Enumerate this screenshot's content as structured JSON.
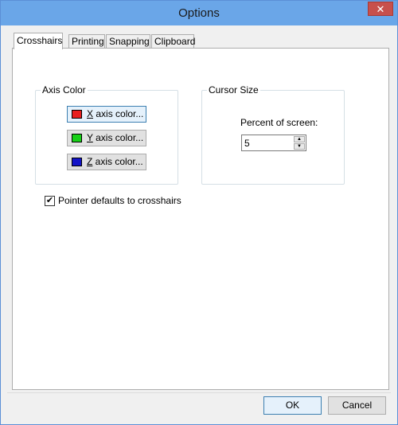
{
  "window": {
    "title": "Options",
    "close_label": "✕"
  },
  "tabs": [
    {
      "label": "Crosshairs",
      "active": true
    },
    {
      "label": "Printing",
      "active": false
    },
    {
      "label": "Snapping",
      "active": false
    },
    {
      "label": "Clipboard",
      "active": false
    }
  ],
  "axis_color": {
    "group_label": "Axis Color",
    "buttons": [
      {
        "label": "X axis color...",
        "accel": "X",
        "rest": " axis color...",
        "color": "#e8201e"
      },
      {
        "label": "Y axis color...",
        "accel": "Y",
        "rest": " axis color...",
        "color": "#18d018"
      },
      {
        "label": "Z axis color...",
        "accel": "Z",
        "rest": " axis color...",
        "color": "#1414c8"
      }
    ]
  },
  "cursor_size": {
    "group_label": "Cursor Size",
    "field_label": "Percent of screen:",
    "value": "5"
  },
  "pointer_checkbox": {
    "label": "Pointer defaults to crosshairs",
    "checked": true
  },
  "footer": {
    "ok_label": "OK",
    "cancel_label": "Cancel"
  }
}
